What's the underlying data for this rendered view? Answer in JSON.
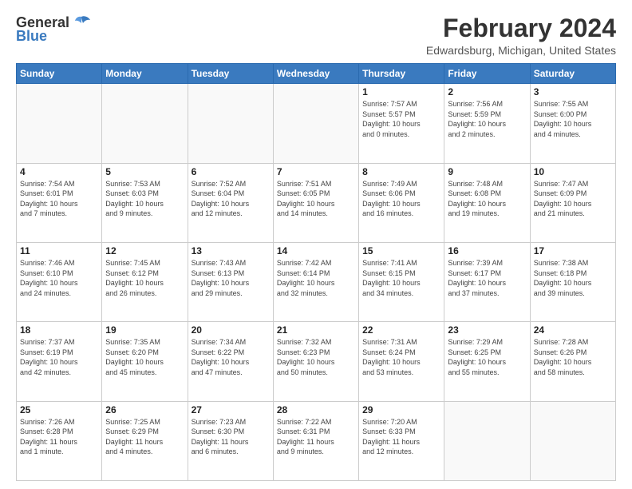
{
  "header": {
    "logo_general": "General",
    "logo_blue": "Blue",
    "title": "February 2024",
    "subtitle": "Edwardsburg, Michigan, United States"
  },
  "weekdays": [
    "Sunday",
    "Monday",
    "Tuesday",
    "Wednesday",
    "Thursday",
    "Friday",
    "Saturday"
  ],
  "weeks": [
    [
      {
        "day": "",
        "info": ""
      },
      {
        "day": "",
        "info": ""
      },
      {
        "day": "",
        "info": ""
      },
      {
        "day": "",
        "info": ""
      },
      {
        "day": "1",
        "info": "Sunrise: 7:57 AM\nSunset: 5:57 PM\nDaylight: 10 hours\nand 0 minutes."
      },
      {
        "day": "2",
        "info": "Sunrise: 7:56 AM\nSunset: 5:59 PM\nDaylight: 10 hours\nand 2 minutes."
      },
      {
        "day": "3",
        "info": "Sunrise: 7:55 AM\nSunset: 6:00 PM\nDaylight: 10 hours\nand 4 minutes."
      }
    ],
    [
      {
        "day": "4",
        "info": "Sunrise: 7:54 AM\nSunset: 6:01 PM\nDaylight: 10 hours\nand 7 minutes."
      },
      {
        "day": "5",
        "info": "Sunrise: 7:53 AM\nSunset: 6:03 PM\nDaylight: 10 hours\nand 9 minutes."
      },
      {
        "day": "6",
        "info": "Sunrise: 7:52 AM\nSunset: 6:04 PM\nDaylight: 10 hours\nand 12 minutes."
      },
      {
        "day": "7",
        "info": "Sunrise: 7:51 AM\nSunset: 6:05 PM\nDaylight: 10 hours\nand 14 minutes."
      },
      {
        "day": "8",
        "info": "Sunrise: 7:49 AM\nSunset: 6:06 PM\nDaylight: 10 hours\nand 16 minutes."
      },
      {
        "day": "9",
        "info": "Sunrise: 7:48 AM\nSunset: 6:08 PM\nDaylight: 10 hours\nand 19 minutes."
      },
      {
        "day": "10",
        "info": "Sunrise: 7:47 AM\nSunset: 6:09 PM\nDaylight: 10 hours\nand 21 minutes."
      }
    ],
    [
      {
        "day": "11",
        "info": "Sunrise: 7:46 AM\nSunset: 6:10 PM\nDaylight: 10 hours\nand 24 minutes."
      },
      {
        "day": "12",
        "info": "Sunrise: 7:45 AM\nSunset: 6:12 PM\nDaylight: 10 hours\nand 26 minutes."
      },
      {
        "day": "13",
        "info": "Sunrise: 7:43 AM\nSunset: 6:13 PM\nDaylight: 10 hours\nand 29 minutes."
      },
      {
        "day": "14",
        "info": "Sunrise: 7:42 AM\nSunset: 6:14 PM\nDaylight: 10 hours\nand 32 minutes."
      },
      {
        "day": "15",
        "info": "Sunrise: 7:41 AM\nSunset: 6:15 PM\nDaylight: 10 hours\nand 34 minutes."
      },
      {
        "day": "16",
        "info": "Sunrise: 7:39 AM\nSunset: 6:17 PM\nDaylight: 10 hours\nand 37 minutes."
      },
      {
        "day": "17",
        "info": "Sunrise: 7:38 AM\nSunset: 6:18 PM\nDaylight: 10 hours\nand 39 minutes."
      }
    ],
    [
      {
        "day": "18",
        "info": "Sunrise: 7:37 AM\nSunset: 6:19 PM\nDaylight: 10 hours\nand 42 minutes."
      },
      {
        "day": "19",
        "info": "Sunrise: 7:35 AM\nSunset: 6:20 PM\nDaylight: 10 hours\nand 45 minutes."
      },
      {
        "day": "20",
        "info": "Sunrise: 7:34 AM\nSunset: 6:22 PM\nDaylight: 10 hours\nand 47 minutes."
      },
      {
        "day": "21",
        "info": "Sunrise: 7:32 AM\nSunset: 6:23 PM\nDaylight: 10 hours\nand 50 minutes."
      },
      {
        "day": "22",
        "info": "Sunrise: 7:31 AM\nSunset: 6:24 PM\nDaylight: 10 hours\nand 53 minutes."
      },
      {
        "day": "23",
        "info": "Sunrise: 7:29 AM\nSunset: 6:25 PM\nDaylight: 10 hours\nand 55 minutes."
      },
      {
        "day": "24",
        "info": "Sunrise: 7:28 AM\nSunset: 6:26 PM\nDaylight: 10 hours\nand 58 minutes."
      }
    ],
    [
      {
        "day": "25",
        "info": "Sunrise: 7:26 AM\nSunset: 6:28 PM\nDaylight: 11 hours\nand 1 minute."
      },
      {
        "day": "26",
        "info": "Sunrise: 7:25 AM\nSunset: 6:29 PM\nDaylight: 11 hours\nand 4 minutes."
      },
      {
        "day": "27",
        "info": "Sunrise: 7:23 AM\nSunset: 6:30 PM\nDaylight: 11 hours\nand 6 minutes."
      },
      {
        "day": "28",
        "info": "Sunrise: 7:22 AM\nSunset: 6:31 PM\nDaylight: 11 hours\nand 9 minutes."
      },
      {
        "day": "29",
        "info": "Sunrise: 7:20 AM\nSunset: 6:33 PM\nDaylight: 11 hours\nand 12 minutes."
      },
      {
        "day": "",
        "info": ""
      },
      {
        "day": "",
        "info": ""
      }
    ]
  ]
}
